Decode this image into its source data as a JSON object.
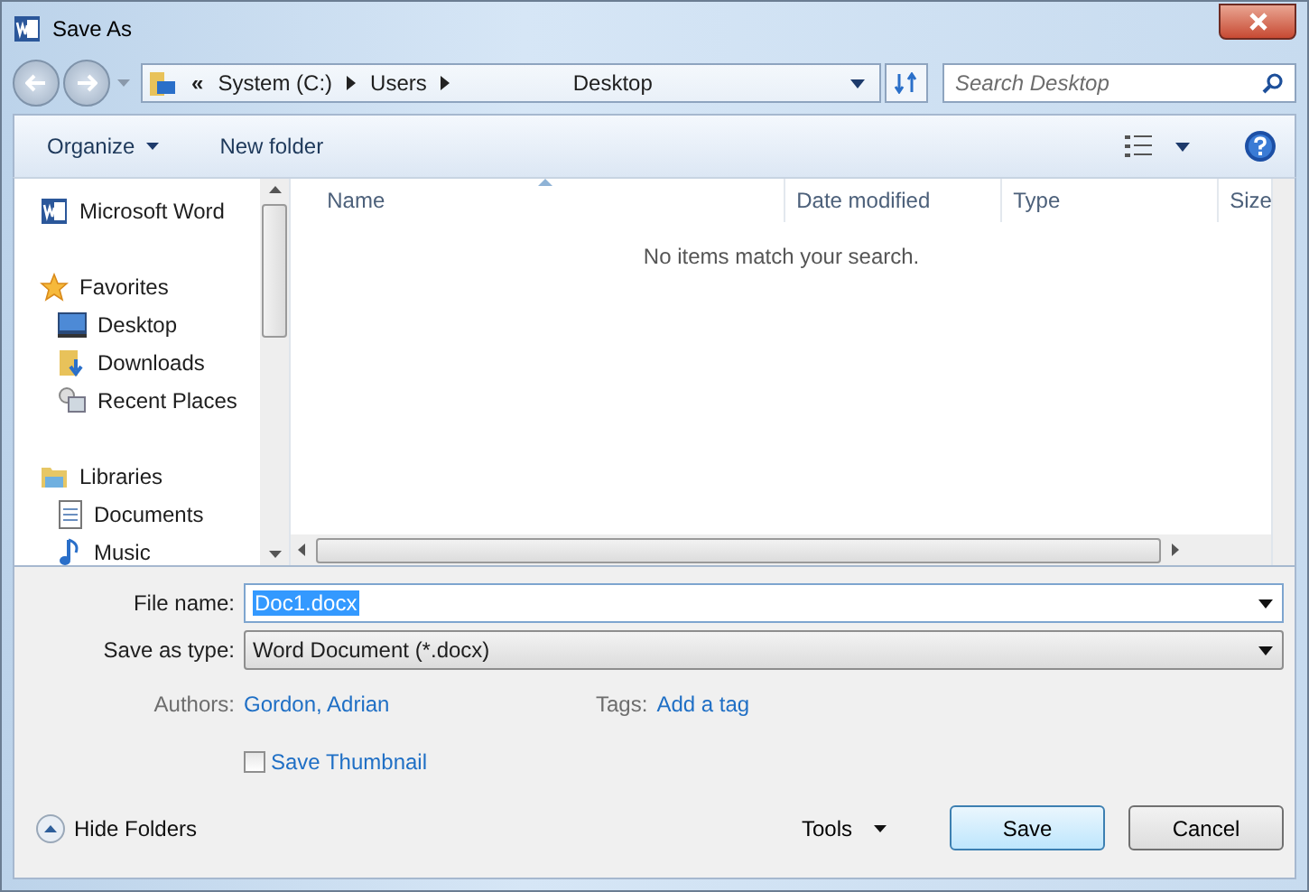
{
  "window": {
    "title": "Save As"
  },
  "address": {
    "overflow": "«",
    "crumbs": [
      "System (C:)",
      "Users",
      "Desktop"
    ]
  },
  "search": {
    "placeholder": "Search Desktop"
  },
  "toolbar": {
    "organize": "Organize",
    "new_folder": "New folder"
  },
  "nav": [
    {
      "label": "Microsoft Word"
    },
    {
      "label": "Favorites",
      "children": [
        {
          "label": "Desktop"
        },
        {
          "label": "Downloads"
        },
        {
          "label": "Recent Places"
        }
      ]
    },
    {
      "label": "Libraries",
      "children": [
        {
          "label": "Documents"
        },
        {
          "label": "Music"
        }
      ]
    }
  ],
  "columns": [
    {
      "label": "Name",
      "sorted": true
    },
    {
      "label": "Date modified",
      "sorted": false
    },
    {
      "label": "Type",
      "sorted": false
    },
    {
      "label": "Size",
      "sorted": false
    }
  ],
  "empty_message": "No items match your search.",
  "form": {
    "file_name": {
      "label": "File name:",
      "value": "Doc1.docx"
    },
    "save_type": {
      "label": "Save as type:",
      "value": "Word Document (*.docx)"
    },
    "authors": {
      "label": "Authors:",
      "value": "Gordon, Adrian"
    },
    "tags": {
      "label": "Tags:",
      "value": "Add a tag"
    },
    "thumbnail": {
      "label": "Save Thumbnail",
      "checked": false
    }
  },
  "hide_folders": "Hide Folders",
  "tools": "Tools",
  "buttons": [
    {
      "label": "Save",
      "default": true
    },
    {
      "label": "Cancel",
      "default": false
    }
  ]
}
